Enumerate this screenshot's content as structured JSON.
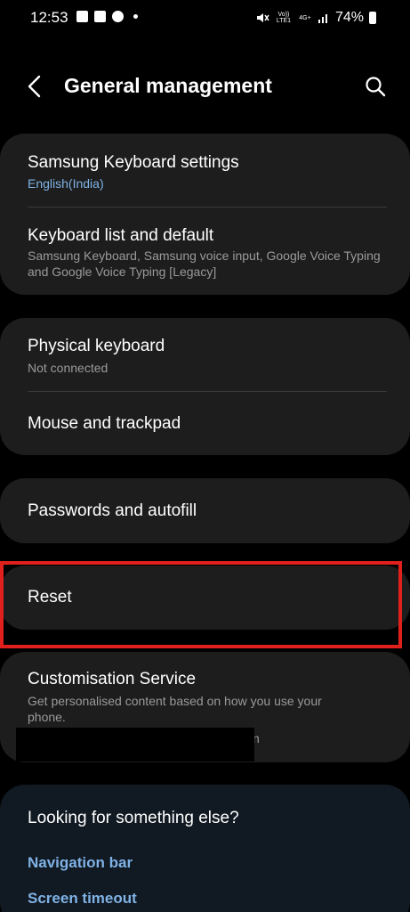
{
  "status_bar": {
    "time": "12:53",
    "battery": "74%",
    "network": "4G+",
    "carrier_tag": "Vo)) LTE1",
    "icons": [
      "image-icon",
      "check-icon",
      "app-icon",
      "dot-icon",
      "mute-icon",
      "signal-icon",
      "battery-icon"
    ]
  },
  "header": {
    "title": "General management",
    "back_icon": "back-arrow-icon",
    "search_icon": "search-icon"
  },
  "groups": [
    {
      "items": [
        {
          "title": "Samsung Keyboard settings",
          "subtitle": "English(India)"
        },
        {
          "title": "Keyboard list and default",
          "subtitle": "Samsung Keyboard, Samsung voice input, Google Voice Typing and Google Voice Typing [Legacy]"
        }
      ]
    },
    {
      "items": [
        {
          "title": "Physical keyboard",
          "subtitle": "Not connected"
        },
        {
          "title": "Mouse and trackpad"
        }
      ]
    },
    {
      "items": [
        {
          "title": "Passwords and autofill"
        }
      ]
    },
    {
      "items": [
        {
          "title": "Reset"
        }
      ]
    },
    {
      "items": [
        {
          "title": "Customisation Service",
          "subtitle": "Get personalised content based on how you use your phone.",
          "subtitle_tail": "n"
        }
      ]
    }
  ],
  "more": {
    "title": "Looking for something else?",
    "links": [
      "Navigation bar",
      "Screen timeout"
    ]
  },
  "colors": {
    "background": "#000000",
    "card": "#1d1d1d",
    "accent": "#7fb2e5",
    "highlight": "#e0201d"
  }
}
